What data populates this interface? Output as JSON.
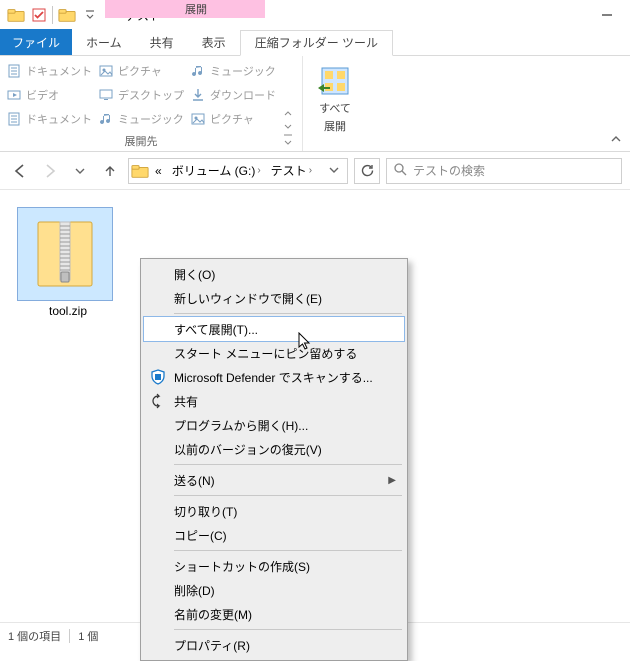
{
  "title": "テスト",
  "context_tab_header": "展開",
  "tabs": {
    "file": "ファイル",
    "home": "ホーム",
    "share": "共有",
    "view": "表示",
    "extract": "圧縮フォルダー ツール"
  },
  "ribbon": {
    "dest_group_label": "展開先",
    "dests": [
      {
        "icon": "document",
        "label": "ドキュメント"
      },
      {
        "icon": "picture",
        "label": "ピクチャ"
      },
      {
        "icon": "music",
        "label": "ミュージック"
      },
      {
        "icon": "video",
        "label": "ビデオ"
      },
      {
        "icon": "desktop",
        "label": "デスクトップ"
      },
      {
        "icon": "download",
        "label": "ダウンロード"
      },
      {
        "icon": "document",
        "label": "ドキュメント"
      },
      {
        "icon": "music",
        "label": "ミュージック"
      },
      {
        "icon": "picture",
        "label": "ピクチャ"
      }
    ],
    "extract_all_line1": "すべて",
    "extract_all_line2": "展開"
  },
  "breadcrumb": {
    "prefix": "«",
    "seg1": "ボリューム (G:)",
    "seg2": "テスト"
  },
  "search_placeholder": "テストの検索",
  "file": {
    "name": "tool.zip"
  },
  "status": {
    "items": "1 個の項目",
    "selected": "1 個"
  },
  "menu": {
    "open": "開く(O)",
    "open_new": "新しいウィンドウで開く(E)",
    "extract_all": "すべて展開(T)...",
    "pin_start": "スタート メニューにピン留めする",
    "defender": "Microsoft Defender でスキャンする...",
    "share": "共有",
    "open_with": "プログラムから開く(H)...",
    "prev_versions": "以前のバージョンの復元(V)",
    "send_to": "送る(N)",
    "cut": "切り取り(T)",
    "copy": "コピー(C)",
    "shortcut": "ショートカットの作成(S)",
    "delete": "削除(D)",
    "rename": "名前の変更(M)",
    "properties": "プロパティ(R)"
  }
}
